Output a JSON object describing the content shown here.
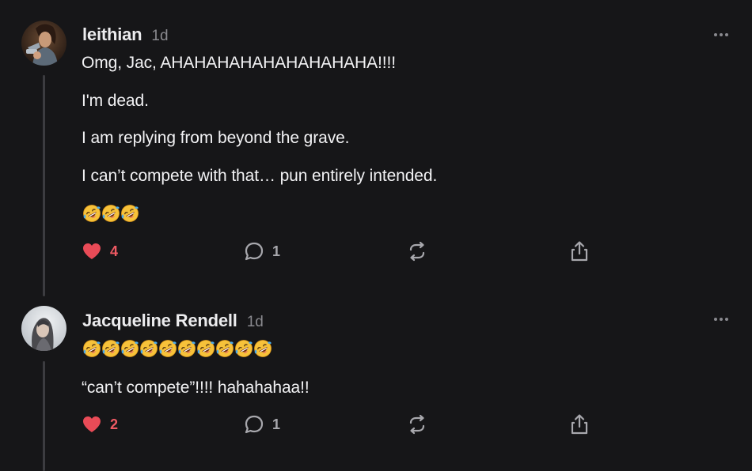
{
  "colors": {
    "background": "#161618",
    "heart": "#e94b57",
    "muted": "#8a8a8f",
    "thread_line": "#3c3c40"
  },
  "comments": [
    {
      "author": "leithian",
      "timestamp": "1d",
      "avatar_icon": "warrior-illustration-avatar",
      "paragraphs": [
        "Omg, Jac, AHAHAHAHAHAHAHAHAHA!!!!",
        "I'm dead.",
        "I am replying from beyond the grave.",
        "I can’t compete with that… pun entirely intended."
      ],
      "emoji_count": 3,
      "emoji_icon": "rolling-on-floor-laughing-emoji",
      "likes": "4",
      "replies": "1"
    },
    {
      "author": "Jacqueline Rendell",
      "timestamp": "1d",
      "avatar_icon": "portrait-photo-avatar",
      "paragraphs": [
        "“can’t compete”!!!! hahahahaa!!"
      ],
      "emoji_count": 10,
      "emoji_icon": "rolling-on-floor-laughing-emoji",
      "likes": "2",
      "replies": "1"
    }
  ],
  "icons": {
    "like": "heart-icon",
    "reply": "comment-bubble-icon",
    "restack": "restack-icon",
    "share": "share-icon",
    "more": "more-options-icon"
  }
}
